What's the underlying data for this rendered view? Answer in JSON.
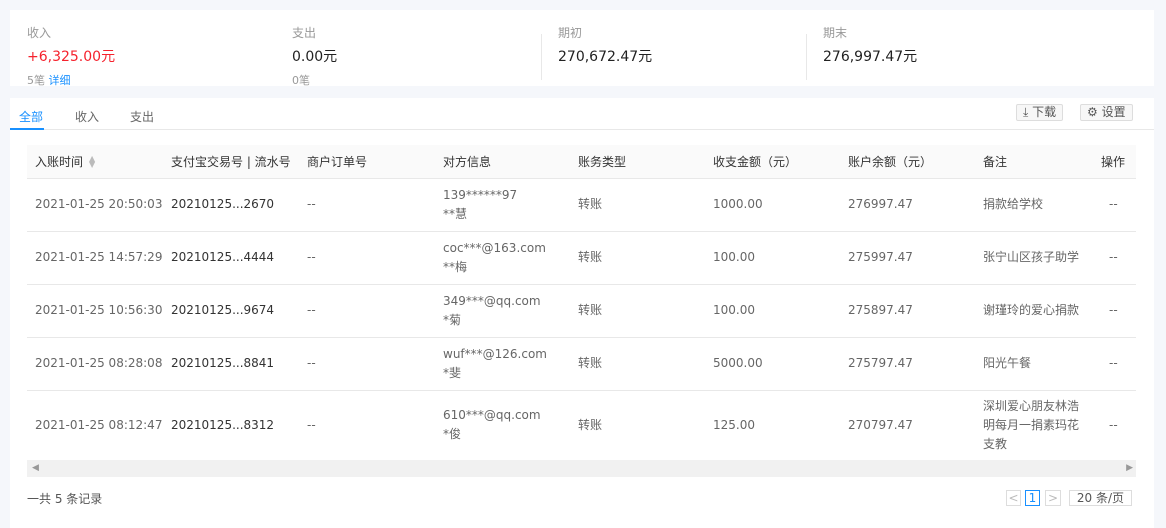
{
  "summary": {
    "income": {
      "label": "收入",
      "value": "+6,325.00",
      "unit": "元",
      "count": "5笔",
      "detail": "详细"
    },
    "expense": {
      "label": "支出",
      "value": "0.00",
      "unit": "元",
      "count": "0笔"
    },
    "opening": {
      "label": "期初",
      "value": "270,672.47",
      "unit": "元"
    },
    "closing": {
      "label": "期末",
      "value": "276,997.47",
      "unit": "元"
    }
  },
  "tabs": [
    "全部",
    "收入",
    "支出"
  ],
  "actions": {
    "download": "下载",
    "settings": "设置"
  },
  "table": {
    "headers": [
      "入账时间",
      "支付宝交易号 | 流水号",
      "商户订单号",
      "对方信息",
      "账务类型",
      "收支金额（元）",
      "账户余额（元）",
      "备注",
      "操作"
    ],
    "rows": [
      [
        "2021-01-25 20:50:03",
        "20210125...2670",
        "--",
        [
          "139******97",
          "**慧"
        ],
        "转账",
        "1000.00",
        "276997.47",
        "捐款给学校",
        "--"
      ],
      [
        "2021-01-25 14:57:29",
        "20210125...4444",
        "--",
        [
          "coc***@163.com",
          "**梅"
        ],
        "转账",
        "100.00",
        "275997.47",
        "张宁山区孩子助学",
        "--"
      ],
      [
        "2021-01-25 10:56:30",
        "20210125...9674",
        "--",
        [
          "349***@qq.com",
          "*菊"
        ],
        "转账",
        "100.00",
        "275897.47",
        "谢瑾玲的爱心捐款",
        "--"
      ],
      [
        "2021-01-25 08:28:08",
        "20210125...8841",
        "--",
        [
          "wuf***@126.com",
          "*斐"
        ],
        "转账",
        "5000.00",
        "275797.47",
        "阳光午餐",
        "--"
      ],
      [
        "2021-01-25 08:12:47",
        "20210125...8312",
        "--",
        [
          "610***@qq.com",
          "*俊"
        ],
        "转账",
        "125.00",
        "270797.47",
        "深圳爱心朋友林浩明每月一捐素玛花支教",
        "--"
      ]
    ]
  },
  "footer": {
    "total": "一共 5 条记录",
    "page": "1",
    "page_size": "20 条/页"
  },
  "colors": {
    "accent": "#1890ff",
    "income": "#f5222d"
  }
}
